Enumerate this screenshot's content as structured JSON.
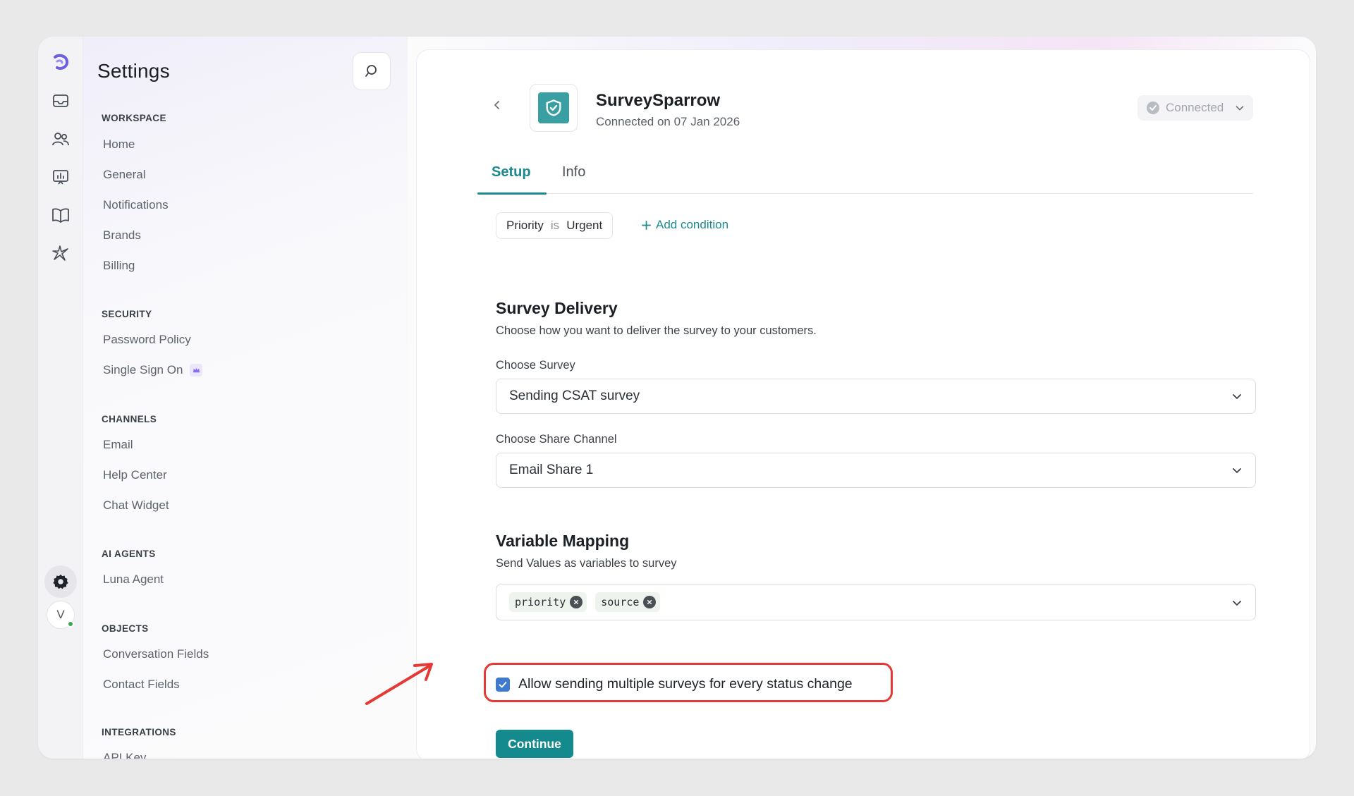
{
  "colors": {
    "accent": "#1b8a8f",
    "highlight": "#e53935",
    "checkbox": "#3d7ad0"
  },
  "rail": {
    "icons": [
      "logo-icon",
      "inbox-icon",
      "contacts-icon",
      "reports-icon",
      "knowledge-base-icon",
      "ai-sparkle-icon",
      "settings-icon"
    ],
    "avatar_initial": "V"
  },
  "sidebar": {
    "title": "Settings",
    "sections": [
      {
        "label": "WORKSPACE",
        "items": [
          "Home",
          "General",
          "Notifications",
          "Brands",
          "Billing"
        ]
      },
      {
        "label": "SECURITY",
        "items": [
          "Password Policy",
          "Single Sign On"
        ]
      },
      {
        "label": "CHANNELS",
        "items": [
          "Email",
          "Help Center",
          "Chat Widget"
        ]
      },
      {
        "label": "AI AGENTS",
        "items": [
          "Luna Agent"
        ]
      },
      {
        "label": "OBJECTS",
        "items": [
          "Conversation Fields",
          "Contact Fields"
        ]
      },
      {
        "label": "INTEGRATIONS",
        "items": [
          "API Key"
        ]
      }
    ]
  },
  "header": {
    "app_name": "SurveySparrow",
    "connected_on": "Connected on 07 Jan 2026",
    "status": "Connected"
  },
  "tabs": [
    {
      "label": "Setup",
      "active": true
    },
    {
      "label": "Info",
      "active": false
    }
  ],
  "condition": {
    "field": "Priority",
    "operator": "is",
    "value": "Urgent",
    "add_label": "Add condition"
  },
  "delivery": {
    "title": "Survey Delivery",
    "description": "Choose how you want to deliver the survey to your customers.",
    "survey_label": "Choose Survey",
    "survey_value": "Sending CSAT survey",
    "channel_label": "Choose Share Channel",
    "channel_value": "Email Share 1"
  },
  "mapping": {
    "title": "Variable Mapping",
    "description": "Send Values as variables to survey",
    "tags": [
      "priority",
      "source"
    ]
  },
  "checkbox": {
    "label": "Allow sending multiple surveys for every status change",
    "checked": true
  },
  "continue_label": "Continue"
}
